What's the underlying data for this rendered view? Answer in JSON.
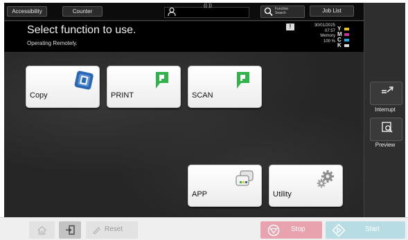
{
  "topbar": {
    "accessibility_label": "Accessibility",
    "counter_label": "Counter",
    "function_search_label_1": "Function",
    "function_search_label_2": "Search",
    "job_list_label": "Job List",
    "comm_indicator": "((·))"
  },
  "message": {
    "title": "Select function to use.",
    "subtitle": "Operating Remotely.",
    "alert_symbol": "!"
  },
  "status": {
    "date": "30/01/2025",
    "time": "07:57",
    "memory_label": "Memory",
    "memory_value": "100 %"
  },
  "toner": [
    {
      "letter": "Y",
      "color": "#e5c21c"
    },
    {
      "letter": "M",
      "color": "#c8329a"
    },
    {
      "letter": "C",
      "color": "#2aa2dc"
    },
    {
      "letter": "K",
      "color": "#dddddd"
    }
  ],
  "functions": {
    "copy_label": "Copy",
    "print_label": "PRINT",
    "scan_label": "SCAN",
    "app_label": "APP",
    "utility_label": "Utility"
  },
  "side": {
    "interrupt_label": "Interrupt",
    "preview_label": "Preview"
  },
  "bottom": {
    "reset_label": "Reset",
    "stop_label": "Stop",
    "start_label": "Start"
  },
  "colors": {
    "accent_green": "#2fb34a",
    "copy_blue": "#2a68b5",
    "stop_pink": "#e9a3ae",
    "start_blue": "#b7dce4"
  }
}
